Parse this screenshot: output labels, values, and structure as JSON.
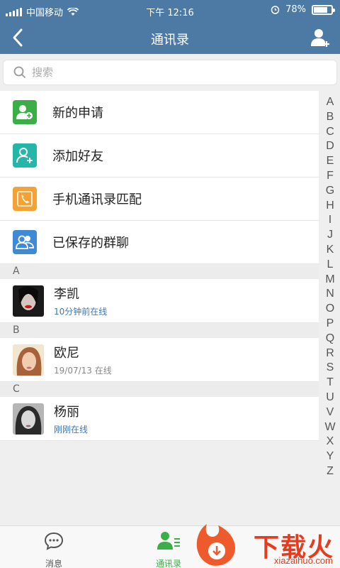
{
  "status_bar": {
    "carrier": "中国移动",
    "time": "下午 12:16",
    "battery_percent": "78%",
    "battery_level": 0.78
  },
  "nav": {
    "title": "通讯录",
    "back_icon": "chevron-left-icon",
    "add_icon": "add-user-icon"
  },
  "search": {
    "placeholder": "搜索"
  },
  "functions": [
    {
      "label": "新的申请",
      "color": "#3cae48",
      "icon": "new-request-icon"
    },
    {
      "label": "添加好友",
      "color": "#24b6a8",
      "icon": "add-friend-icon"
    },
    {
      "label": "手机通讯录匹配",
      "color": "#f5a235",
      "icon": "phonebook-icon"
    },
    {
      "label": "已保存的群聊",
      "color": "#3e8ad6",
      "icon": "group-chat-icon"
    }
  ],
  "sections": [
    {
      "letter": "A",
      "contacts": [
        {
          "name": "李凯",
          "status": "10分钟前在线"
        }
      ]
    },
    {
      "letter": "B",
      "contacts": [
        {
          "name": "欧尼",
          "status": "19/07/13 在线"
        }
      ]
    },
    {
      "letter": "C",
      "contacts": [
        {
          "name": "杨丽",
          "status": "刚刚在线"
        }
      ]
    }
  ],
  "index_letters": [
    "A",
    "B",
    "C",
    "D",
    "E",
    "F",
    "G",
    "H",
    "I",
    "J",
    "K",
    "L",
    "M",
    "N",
    "O",
    "P",
    "Q",
    "R",
    "S",
    "T",
    "U",
    "V",
    "W",
    "X",
    "Y",
    "Z"
  ],
  "tabs": [
    {
      "label": "消息",
      "icon": "chat-bubble-icon"
    },
    {
      "label": "通讯录",
      "icon": "contacts-icon",
      "active": true
    }
  ],
  "watermark": {
    "text": "下载火",
    "sub": "xiazaihuo.com"
  },
  "colors": {
    "primary": "#4d7aa4",
    "active_tab": "#3cae48",
    "link": "#3a78b8"
  }
}
